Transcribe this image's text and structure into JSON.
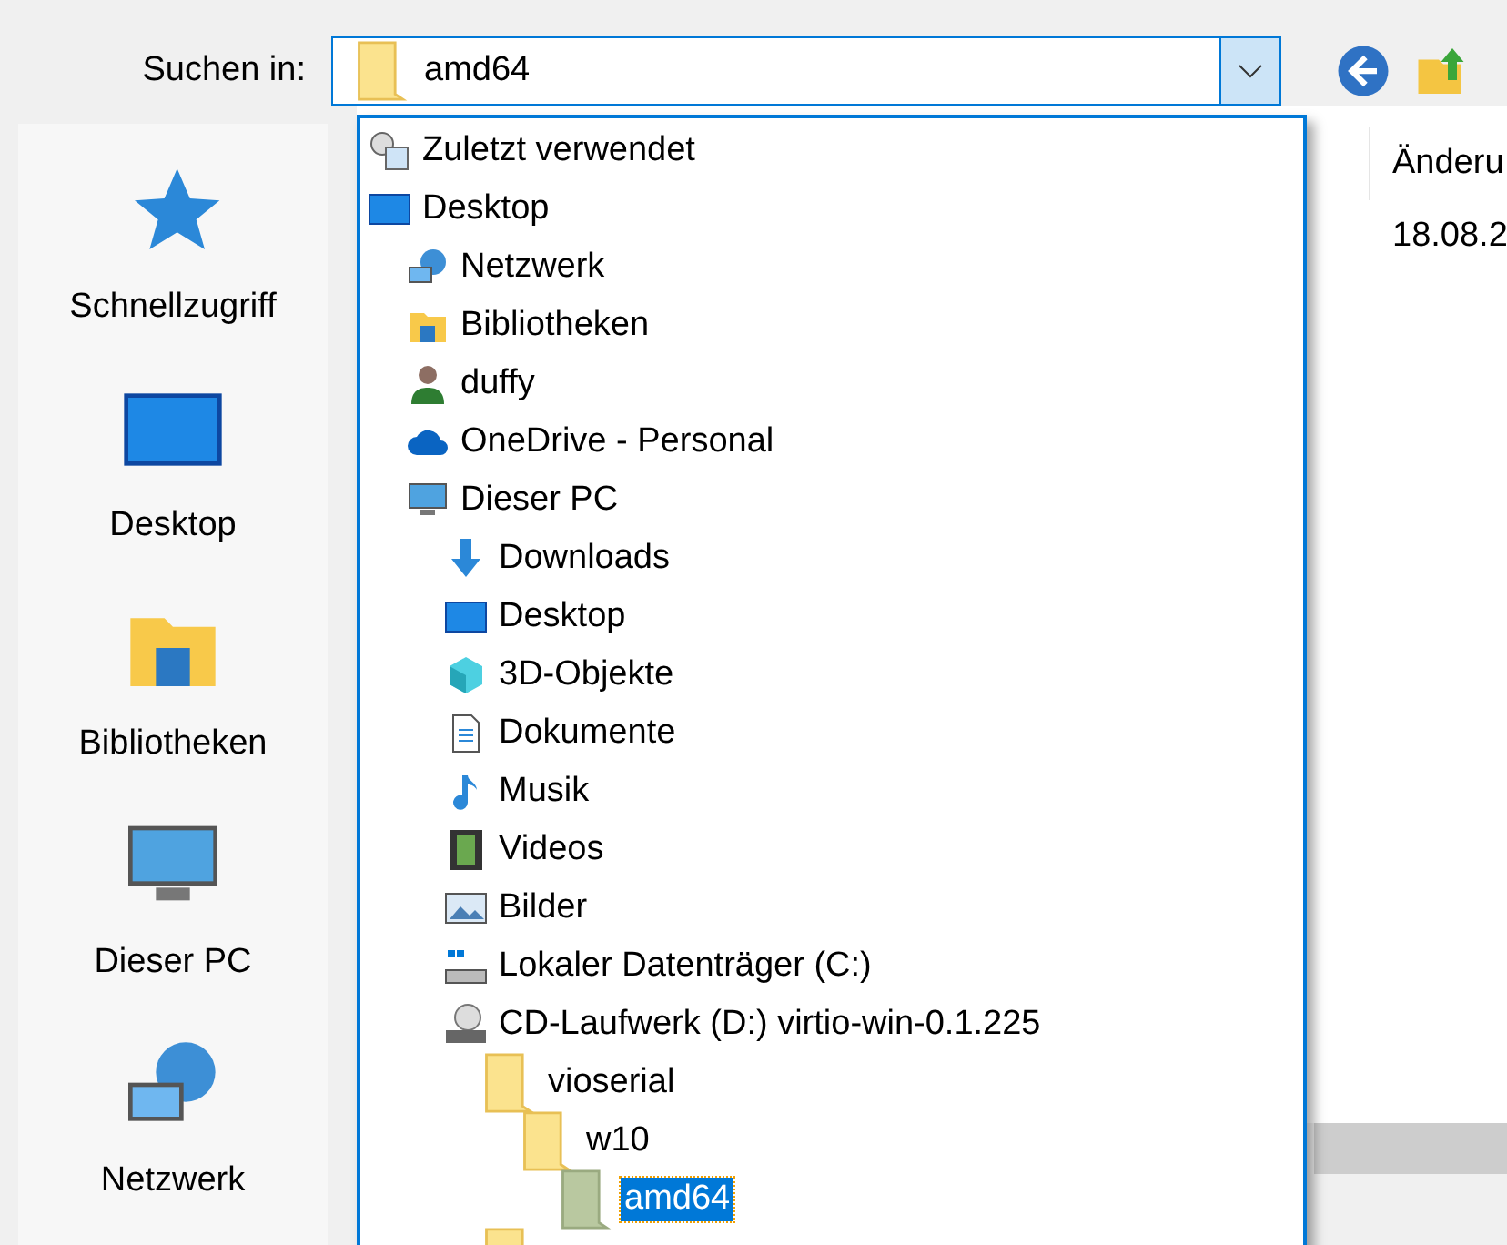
{
  "look_in": {
    "label": "Suchen in:",
    "value": "amd64"
  },
  "places": [
    {
      "label": "Schnellzugriff",
      "kind": "quick"
    },
    {
      "label": "Desktop",
      "kind": "desktop"
    },
    {
      "label": "Bibliotheken",
      "kind": "library"
    },
    {
      "label": "Dieser PC",
      "kind": "pc"
    },
    {
      "label": "Netzwerk",
      "kind": "network"
    }
  ],
  "dropdown": [
    {
      "label": "Zuletzt verwendet",
      "kind": "recent",
      "selected": false
    },
    {
      "label": "Desktop",
      "kind": "desktop",
      "selected": false,
      "children": [
        {
          "label": "Netzwerk",
          "kind": "network",
          "selected": false
        },
        {
          "label": "Bibliotheken",
          "kind": "library",
          "selected": false
        },
        {
          "label": "duffy",
          "kind": "user",
          "selected": false
        },
        {
          "label": "OneDrive - Personal",
          "kind": "cloud",
          "selected": false
        },
        {
          "label": "Dieser PC",
          "kind": "pc",
          "selected": false,
          "children": [
            {
              "label": "Downloads",
              "kind": "downloads",
              "selected": false
            },
            {
              "label": "Desktop",
              "kind": "desktop",
              "selected": false
            },
            {
              "label": "3D-Objekte",
              "kind": "cube",
              "selected": false
            },
            {
              "label": "Dokumente",
              "kind": "document",
              "selected": false
            },
            {
              "label": "Musik",
              "kind": "music",
              "selected": false
            },
            {
              "label": "Videos",
              "kind": "video",
              "selected": false
            },
            {
              "label": "Bilder",
              "kind": "picture",
              "selected": false
            },
            {
              "label": "Lokaler Datenträger (C:)",
              "kind": "drive",
              "selected": false
            },
            {
              "label": "CD-Laufwerk (D:) virtio-win-0.1.225",
              "kind": "cd",
              "selected": false,
              "children": [
                {
                  "label": "vioserial",
                  "kind": "folder",
                  "selected": false,
                  "children": [
                    {
                      "label": "w10",
                      "kind": "folder",
                      "selected": false,
                      "children": [
                        {
                          "label": "amd64",
                          "kind": "folder",
                          "selected": true
                        }
                      ]
                    }
                  ]
                }
              ]
            }
          ]
        }
      ]
    }
  ],
  "file_list": {
    "column_2": "Änderu",
    "rows": [
      {
        "column_2": "18.08.2"
      }
    ]
  }
}
